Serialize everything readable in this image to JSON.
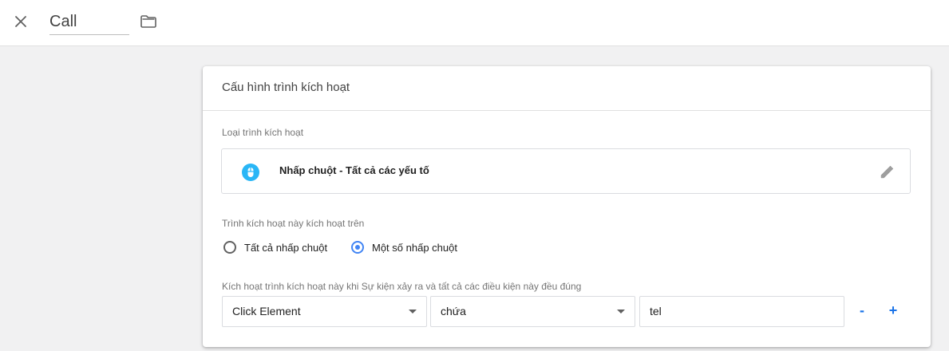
{
  "topbar": {
    "close_icon": "close-icon",
    "title": "Call",
    "folder_icon": "folder-icon"
  },
  "card": {
    "header": "Cấu hình trình kích hoạt",
    "trigger_type_label": "Loại trình kích hoạt",
    "trigger": {
      "icon": "mouse-icon",
      "name": "Nhấp chuột - Tất cả các yếu tố",
      "edit_icon": "pencil-icon"
    },
    "fires_on_label": "Trình kích hoạt này kích hoạt trên",
    "radio_options": [
      {
        "label": "Tất cả nhấp chuột",
        "checked": false
      },
      {
        "label": "Một số nhấp chuột",
        "checked": true
      }
    ],
    "condition_label": "Kích hoạt trình kích hoạt này khi Sự kiện xảy ra và tất cả các điều kiện này đều đúng",
    "condition": {
      "variable": "Click Element",
      "operator": "chứa",
      "value": "tel",
      "remove_label": "-",
      "add_label": "+"
    }
  },
  "colors": {
    "accent": "#4285f4",
    "link_blue": "#1a73e8",
    "mouse_icon": "#29b6f6"
  }
}
